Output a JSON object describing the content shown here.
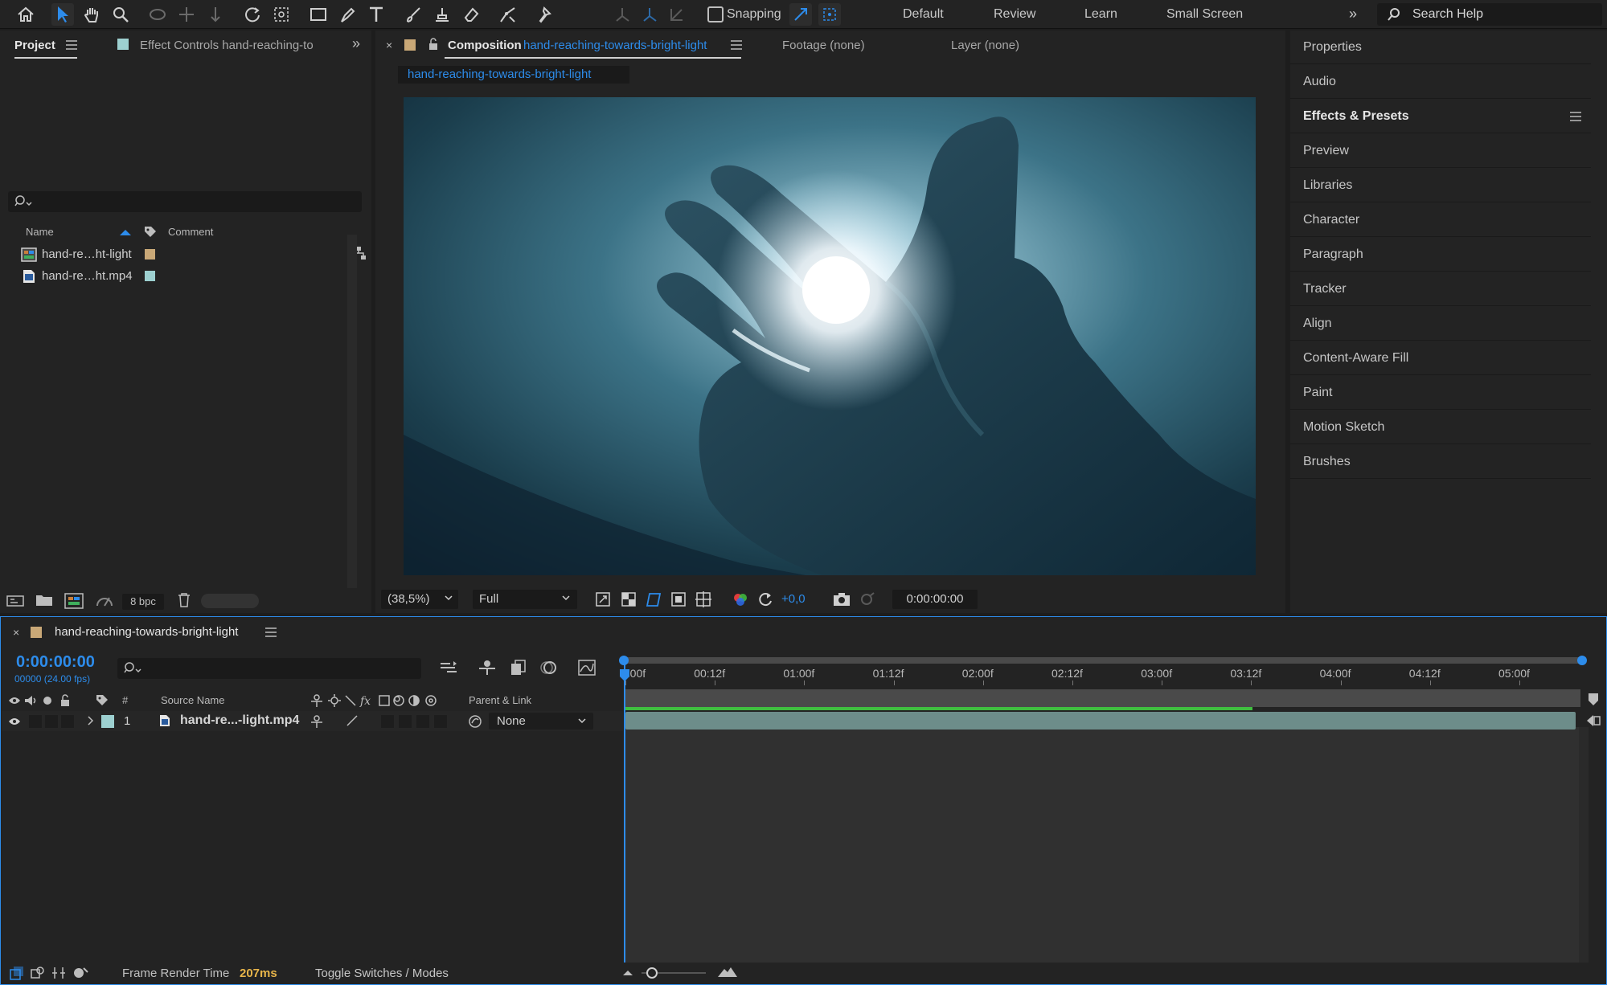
{
  "toolbar": {
    "snapping_label": "Snapping",
    "workspaces": [
      "Default",
      "Review",
      "Learn",
      "Small Screen"
    ],
    "search_placeholder": "Search Help"
  },
  "project_panel": {
    "tab_project": "Project",
    "tab_effect_controls": "Effect Controls hand-reaching-to",
    "columns": {
      "name": "Name",
      "comment": "Comment"
    },
    "items": [
      {
        "name": "hand-re…ht-light",
        "icon": "composition-icon",
        "label_color": "#c9a877"
      },
      {
        "name": "hand-re…ht.mp4",
        "icon": "footage-icon",
        "label_color": "#9dd0d0"
      }
    ],
    "bpc": "8 bpc"
  },
  "composition_panel": {
    "tab_prefix": "Composition",
    "tab_name": "hand-reaching-towards-bright-light",
    "footage_tab": "Footage (none)",
    "layer_tab": "Layer (none)",
    "sub_tab": "hand-reaching-towards-bright-light",
    "zoom": "(38,5%)",
    "resolution": "Full",
    "exposure": "+0,0",
    "timecode": "0:00:00:00"
  },
  "right_panel": {
    "items": [
      "Properties",
      "Audio",
      "Effects & Presets",
      "Preview",
      "Libraries",
      "Character",
      "Paragraph",
      "Tracker",
      "Align",
      "Content-Aware Fill",
      "Paint",
      "Motion Sketch",
      "Brushes"
    ]
  },
  "timeline": {
    "comp_name": "hand-reaching-towards-bright-light",
    "current_time": "0:00:00:00",
    "frame_info": "00000 (24.00 fps)",
    "ruler_labels": [
      "0:00f",
      "00:12f",
      "01:00f",
      "01:12f",
      "02:00f",
      "02:12f",
      "03:00f",
      "03:12f",
      "04:00f",
      "04:12f",
      "05:00f"
    ],
    "columns": {
      "number": "#",
      "source_name": "Source Name",
      "parent_link": "Parent & Link"
    },
    "layers": [
      {
        "number": "1",
        "source_name": "hand-re...-light.mp4",
        "parent": "None"
      }
    ],
    "work_area_rendered_fraction": 0.66
  },
  "status_bar": {
    "frame_render_label": "Frame Render Time",
    "frame_render_value": "207ms",
    "toggle_label": "Toggle Switches / Modes"
  },
  "colors": {
    "accent_blue": "#2d8ceb",
    "render_green": "#3fbf3f",
    "render_time_color": "#e8b54a"
  }
}
